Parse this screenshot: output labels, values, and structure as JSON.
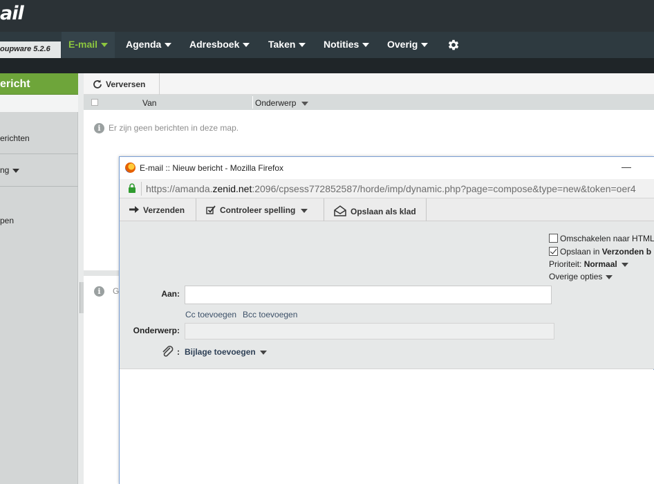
{
  "header": {
    "logo_text": "ail"
  },
  "menubar": {
    "version": "oupware 5.2.6",
    "items": [
      {
        "label": "E-mail",
        "active": true
      },
      {
        "label": "Agenda"
      },
      {
        "label": "Adresboek"
      },
      {
        "label": "Taken"
      },
      {
        "label": "Notities"
      },
      {
        "label": "Overig"
      }
    ],
    "settings_icon": "gear-icon"
  },
  "sidebar": {
    "new_message": "ericht",
    "items": [
      {
        "label": "erichten"
      },
      {
        "label": "ng"
      },
      {
        "label": "pen"
      }
    ]
  },
  "list": {
    "refresh_label": "Verversen",
    "columns": [
      "Van",
      "Onderwerp"
    ],
    "empty_message": "Er zijn geen berichten in deze map.",
    "preview_partial": "G"
  },
  "popup": {
    "window_title": "E-mail :: Nieuw bericht - Mozilla Firefox",
    "minimize": "—",
    "url_prefix": "https://amanda.",
    "url_domain": "zenid.net",
    "url_rest": ":2096/cpsess772852587/horde/imp/dynamic.php?page=compose&type=new&token=oer4",
    "toolbar": {
      "send": "Verzenden",
      "spell": "Controleer spelling",
      "draft": "Opslaan als klad"
    },
    "options": {
      "html_toggle": "Omschakelen naar HTML",
      "save_prefix": "Opslaan in ",
      "save_folder": "Verzonden b",
      "priority_label": "Prioriteit: ",
      "priority_value": "Normaal",
      "other_options": "Overige opties"
    },
    "form": {
      "to_label": "Aan:",
      "to_value": "",
      "cc_link": "Cc toevoegen",
      "bcc_link": "Bcc toevoegen",
      "subject_label": "Onderwerp:",
      "subject_value": "",
      "attach_sep": ":",
      "attach_label": "Bijlage toevoegen"
    }
  }
}
